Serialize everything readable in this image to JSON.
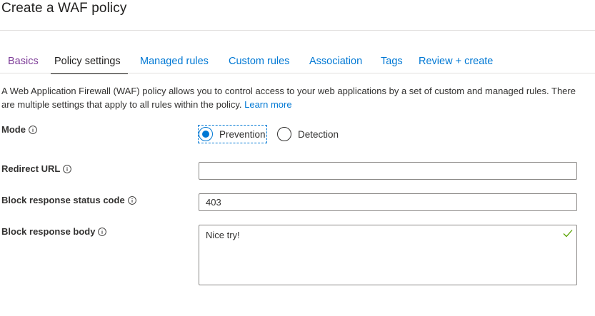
{
  "title": "Create a WAF policy",
  "tabs": [
    {
      "label": "Basics"
    },
    {
      "label": "Policy settings"
    },
    {
      "label": "Managed rules"
    },
    {
      "label": "Custom rules"
    },
    {
      "label": "Association"
    },
    {
      "label": "Tags"
    },
    {
      "label": "Review + create"
    }
  ],
  "description": {
    "text": "A Web Application Firewall (WAF) policy allows you to control access to your web applications by a set of custom and managed rules. There are multiple settings that apply to all rules within the policy.",
    "link": "Learn more"
  },
  "mode": {
    "label": "Mode",
    "options": [
      {
        "label": "Prevention"
      },
      {
        "label": "Detection"
      }
    ],
    "selected": "Prevention"
  },
  "redirect_url": {
    "label": "Redirect URL",
    "value": ""
  },
  "block_status_code": {
    "label": "Block response status code",
    "value": "403"
  },
  "block_body": {
    "label": "Block response body",
    "value": "Nice try!"
  },
  "colors": {
    "accent": "#0078d4",
    "visited": "#7d3c98",
    "valid": "#57a300"
  }
}
